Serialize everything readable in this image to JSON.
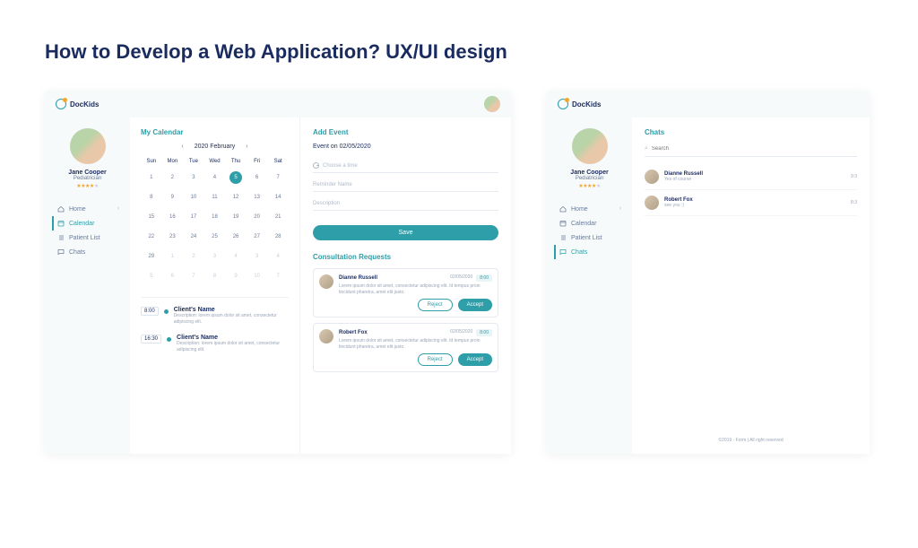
{
  "page_title": "How to Develop a Web Application? UX/UI design",
  "brand": "DocKids",
  "profile": {
    "name": "Jane Cooper",
    "role": "Pediatrician"
  },
  "nav": {
    "home": "Home",
    "calendar": "Calendar",
    "patient_list": "Patient List",
    "chats": "Chats"
  },
  "calendar": {
    "title": "My Calendar",
    "period": "2020  February",
    "days": [
      "Sun",
      "Mon",
      "Tue",
      "Wed",
      "Thu",
      "Fri",
      "Sat"
    ],
    "events": [
      {
        "time": "8:00",
        "name": "Client's Name",
        "desc": "Description: lorem ipsum dolor sit amet, consectetur adipiscing elit."
      },
      {
        "time": "16:30",
        "name": "Client's Name",
        "desc": "Description: lorem ipsum dolor sit amet, consectetur adipiscing elit."
      }
    ]
  },
  "add_event": {
    "title": "Add Event",
    "date_label": "Event on 02/05/2020",
    "time_ph": "Choose a time",
    "reminder_ph": "Reminder Name",
    "desc_ph": "Description",
    "save": "Save"
  },
  "consult": {
    "title": "Consultation Requests",
    "reject": "Reject",
    "accept": "Accept",
    "items": [
      {
        "name": "Dianne Russell",
        "date": "02/05/2020",
        "time": "8:00",
        "desc": "Lorem ipsum dolor sit amet, consectetur adipiscing elit. Id tempus proin tincidunt pharetra, amet elit justo."
      },
      {
        "name": "Robert Fox",
        "date": "02/05/2020",
        "time": "8:00",
        "desc": "Lorem ipsum dolor sit amet, consectetur adipiscing elit. Id tempus proin tincidunt pharetra, amet elit justo."
      }
    ]
  },
  "chats": {
    "title": "Chats",
    "search_ph": "Search",
    "items": [
      {
        "name": "Dianne Russell",
        "msg": "Yes of course",
        "time": "9:3"
      },
      {
        "name": "Robert Fox",
        "msg": "see you :)",
        "time": "8:3"
      }
    ]
  },
  "footer": "©2019 - Form  |  All right reserved"
}
